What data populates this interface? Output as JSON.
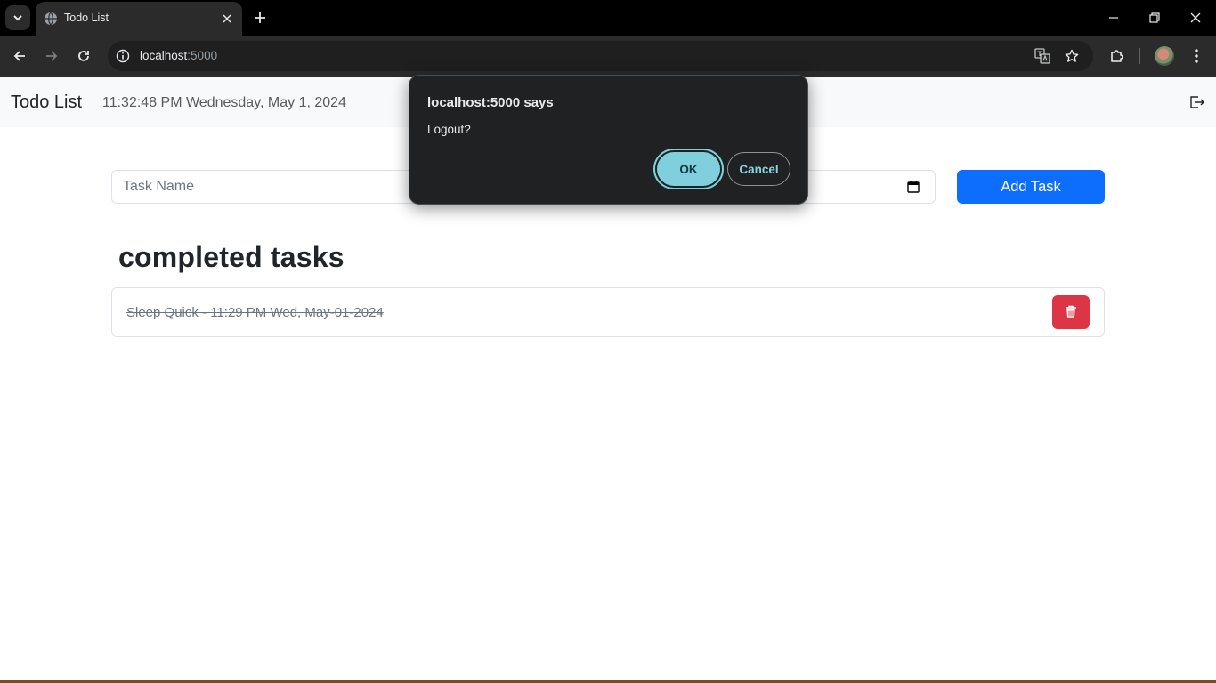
{
  "browser": {
    "tab_title": "Todo List",
    "url_host": "localhost",
    "url_port": ":5000"
  },
  "navbar": {
    "brand": "Todo List",
    "datetime": "11:32:48 PM Wednesday, May 1, 2024",
    "logout_icon": "logout-icon"
  },
  "form": {
    "task_placeholder": "Task Name",
    "add_label": "Add Task"
  },
  "completed": {
    "heading": "completed tasks",
    "tasks": [
      {
        "text": "Sleep Quick - 11:29 PM Wed, May-01-2024"
      }
    ]
  },
  "dialog": {
    "title": "localhost:5000 says",
    "message": "Logout?",
    "ok_label": "OK",
    "cancel_label": "Cancel"
  },
  "colors": {
    "primary": "#0d6efd",
    "danger": "#dc3545",
    "dialog_accent": "#7fcfdc"
  }
}
